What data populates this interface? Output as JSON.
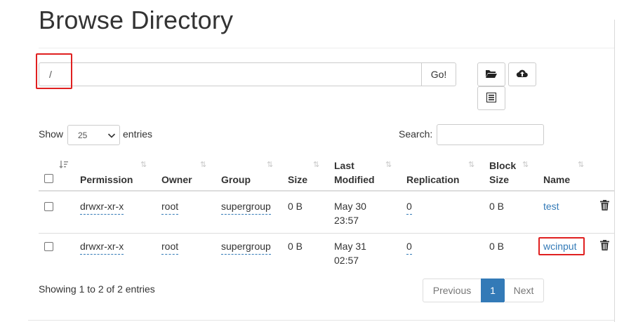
{
  "page": {
    "title": "Browse Directory"
  },
  "path_bar": {
    "value": "/",
    "go_label": "Go!"
  },
  "toolbar": {
    "icons": [
      "folder-open-icon",
      "cloud-upload-icon",
      "list-icon"
    ]
  },
  "table_controls": {
    "show_label": "Show",
    "entries_value": "25",
    "entries_label": "entries",
    "search_label": "Search:",
    "search_value": ""
  },
  "table": {
    "columns": [
      "Permission",
      "Owner",
      "Group",
      "Size",
      "Last Modified",
      "Replication",
      "Block Size",
      "Name"
    ],
    "column_lines": {
      "last_modified": [
        "Last",
        "Modified"
      ],
      "block_size": [
        "Block",
        "Size"
      ]
    },
    "rows": [
      {
        "permission": "drwxr-xr-x",
        "owner": "root",
        "group": "supergroup",
        "size": "0 B",
        "modified_date": "May 30",
        "modified_time": "23:57",
        "replication": "0",
        "block_size": "0 B",
        "name": "test"
      },
      {
        "permission": "drwxr-xr-x",
        "owner": "root",
        "group": "supergroup",
        "size": "0 B",
        "modified_date": "May 31",
        "modified_time": "02:57",
        "replication": "0",
        "block_size": "0 B",
        "name": "wcinput"
      }
    ]
  },
  "footer": {
    "info": "Showing 1 to 2 of 2 entries",
    "pagination": {
      "previous": "Previous",
      "current": "1",
      "next": "Next"
    }
  },
  "colors": {
    "link": "#337ab7",
    "highlight": "#e02020",
    "active_page": "#337ab7"
  }
}
